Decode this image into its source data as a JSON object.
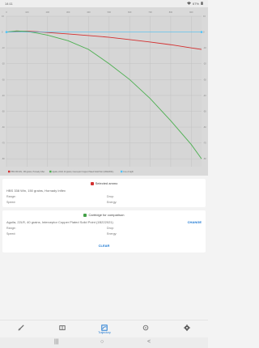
{
  "status_bar": {
    "time": "14:11",
    "battery": "67%"
  },
  "chart_data": {
    "type": "line",
    "title": "",
    "xlabel": "",
    "ylabel": "",
    "x_ticks": [
      "0",
      "100",
      "200",
      "300",
      "400",
      "500",
      "600",
      "700",
      "800",
      "900"
    ],
    "y_ticks": [
      "10",
      "0",
      "-10",
      "-20",
      "-30",
      "-40",
      "-50",
      "-60",
      "-70",
      "-80"
    ],
    "xlim": [
      0,
      950
    ],
    "ylim": [
      -85,
      10
    ],
    "grid": true,
    "legend_position": "bottom",
    "series": [
      {
        "name": "HBS 338 Win, 150 grains, Hornady Inflex",
        "color": "#d32f2f",
        "x": [
          0,
          50,
          100,
          150,
          200,
          300,
          400,
          500,
          600,
          700,
          800,
          900,
          950
        ],
        "y": [
          0,
          0.4,
          0.5,
          0.2,
          -0.3,
          -1.2,
          -2.2,
          -3.3,
          -4.8,
          -6.3,
          -8,
          -10,
          -11
        ]
      },
      {
        "name": "Aguila, 22LR, 40 grains, Interceptor Copper Plated Solid Point (1B222021)",
        "color": "#4caf50",
        "x": [
          0,
          50,
          100,
          150,
          200,
          300,
          400,
          500,
          600,
          700,
          800,
          900,
          950
        ],
        "y": [
          0,
          0.7,
          0.3,
          -0.7,
          -2,
          -5.5,
          -11,
          -20,
          -30,
          -42,
          -56,
          -71,
          -80
        ]
      },
      {
        "name": "Line of sight",
        "color": "#4fc3f7",
        "x": [
          0,
          950
        ],
        "y": [
          0,
          0
        ]
      }
    ]
  },
  "selected_ammo": {
    "title": "Selected ammo",
    "color": "#d32f2f",
    "name": "HBS 338 Win, 150 grains, Hornady Inflex",
    "range_label": "Range:",
    "drop_label": "Drop:",
    "speed_label": "Speed:",
    "energy_label": "Energy:"
  },
  "comparison": {
    "title": "Cartridge for comparison",
    "color": "#43a047",
    "name": "Aguila, 22LR, 40 grains, Interceptor Copper Plated Solid Point (1B222021)",
    "change_label": "CHANGE",
    "range_label": "Range:",
    "drop_label": "Drop:",
    "speed_label": "Speed:",
    "energy_label": "Energy:",
    "clear_label": "CLEAR"
  },
  "bottom_nav": {
    "active_label": "Trajectory",
    "items": [
      "rifle-icon",
      "book-icon",
      "trajectory-icon",
      "target-icon",
      "settings-icon"
    ]
  },
  "system_nav": {
    "recent": "|||",
    "home": "○",
    "back": "<"
  },
  "accent": "#1976d2"
}
